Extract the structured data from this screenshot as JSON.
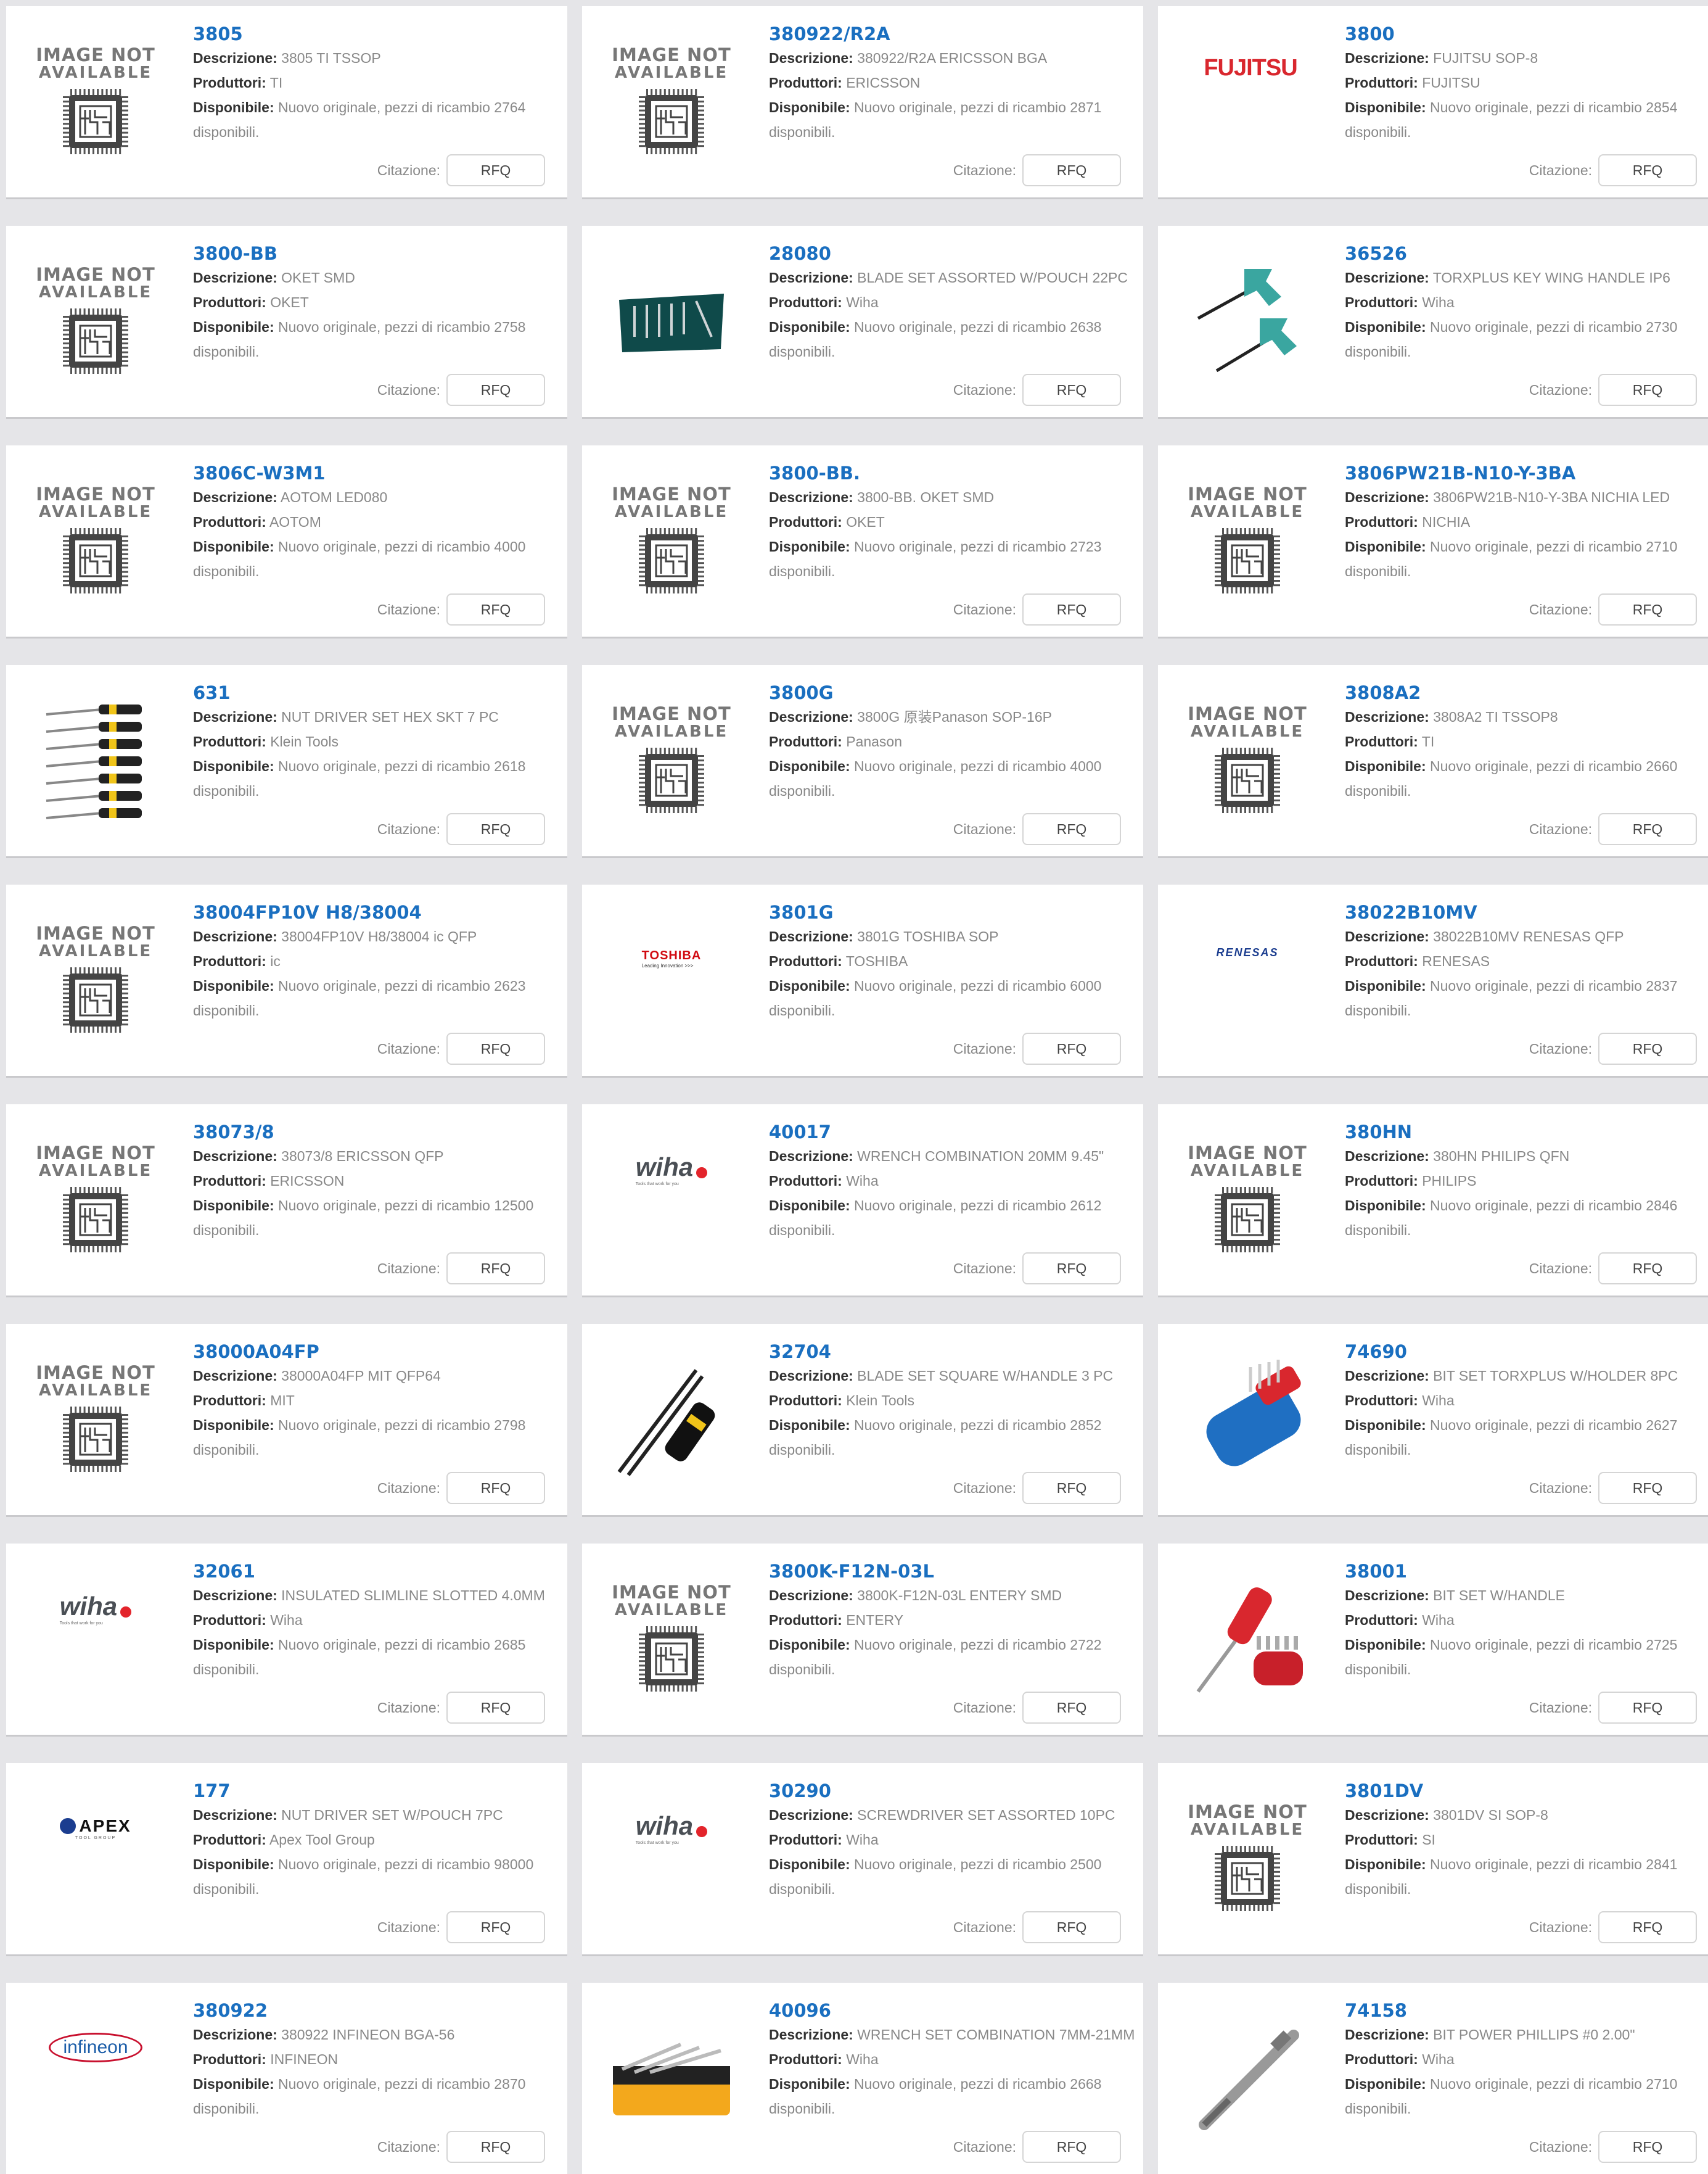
{
  "labels": {
    "descrizione": "Descrizione:",
    "produttori": "Produttori:",
    "disponibile": "Disponibile:",
    "citazione": "Citazione:",
    "rfq": "RFQ",
    "na_line1": "IMAGE NOT",
    "na_line2": "AVAILABLE"
  },
  "products": [
    {
      "pn": "3805",
      "desc": "3805 TI TSSOP",
      "mfr": "TI",
      "avail": "Nuovo originale, pezzi di ricambio 2764",
      "avail2": "disponibili.",
      "img": "na"
    },
    {
      "pn": "380922/R2A",
      "desc": "380922/R2A ERICSSON BGA",
      "mfr": "ERICSSON",
      "avail": "Nuovo originale, pezzi di ricambio 2871",
      "avail2": "disponibili.",
      "img": "na"
    },
    {
      "pn": "3800",
      "desc": "FUJITSU SOP-8",
      "mfr": "FUJITSU",
      "avail": "Nuovo originale, pezzi di ricambio 2854",
      "avail2": "disponibili.",
      "img": "fujitsu",
      "logo": "FUJITSU"
    },
    {
      "pn": "3800-BB",
      "desc": "OKET SMD",
      "mfr": "OKET",
      "avail": "Nuovo originale, pezzi di ricambio 2758",
      "avail2": "disponibili.",
      "img": "na"
    },
    {
      "pn": "28080",
      "desc": "BLADE SET ASSORTED W/POUCH 22PC",
      "mfr": "Wiha",
      "avail": "Nuovo originale, pezzi di ricambio 2638",
      "avail2": "disponibili.",
      "img": "pouch"
    },
    {
      "pn": "36526",
      "desc": "TORXPLUS KEY WING HANDLE IP6",
      "mfr": "Wiha",
      "avail": "Nuovo originale, pezzi di ricambio 2730",
      "avail2": "disponibili.",
      "img": "tkeys"
    },
    {
      "pn": "3806C-W3M1",
      "desc": "AOTOM LED080",
      "mfr": "AOTOM",
      "avail": "Nuovo originale, pezzi di ricambio 4000",
      "avail2": "disponibili.",
      "img": "na"
    },
    {
      "pn": "3800-BB.",
      "desc": "3800-BB. OKET SMD",
      "mfr": "OKET",
      "avail": "Nuovo originale, pezzi di ricambio 2723",
      "avail2": "disponibili.",
      "img": "na"
    },
    {
      "pn": "3806PW21B-N10-Y-3BA",
      "desc": "3806PW21B-N10-Y-3BA NICHIA LED",
      "mfr": "NICHIA",
      "avail": "Nuovo originale, pezzi di ricambio 2710",
      "avail2": "disponibili.",
      "img": "na"
    },
    {
      "pn": "631",
      "desc": "NUT DRIVER SET HEX SKT 7 PC",
      "mfr": "Klein Tools",
      "avail": "Nuovo originale, pezzi di ricambio 2618",
      "avail2": "disponibili.",
      "img": "drivers"
    },
    {
      "pn": "3800G",
      "desc": "3800G 原装Panason SOP-16P",
      "mfr": "Panason",
      "avail": "Nuovo originale, pezzi di ricambio 4000",
      "avail2": "disponibili.",
      "img": "na"
    },
    {
      "pn": "3808A2",
      "desc": "3808A2 TI TSSOP8",
      "mfr": "TI",
      "avail": "Nuovo originale, pezzi di ricambio 2660",
      "avail2": "disponibili.",
      "img": "na"
    },
    {
      "pn": "38004FP10V H8/38004",
      "desc": "38004FP10V H8/38004 ic QFP",
      "mfr": "ic",
      "avail": "Nuovo originale, pezzi di ricambio 2623",
      "avail2": "disponibili.",
      "img": "na"
    },
    {
      "pn": "3801G",
      "desc": "3801G TOSHIBA SOP",
      "mfr": "TOSHIBA",
      "avail": "Nuovo originale, pezzi di ricambio 6000",
      "avail2": "disponibili.",
      "img": "toshiba",
      "logo": "TOSHIBA",
      "logo_sub": "Leading Innovation >>>"
    },
    {
      "pn": "38022B10MV",
      "desc": "38022B10MV RENESAS QFP",
      "mfr": "RENESAS",
      "avail": "Nuovo originale, pezzi di ricambio 2837",
      "avail2": "disponibili.",
      "img": "renesas",
      "logo": "RENESAS"
    },
    {
      "pn": "38073/8",
      "desc": "38073/8 ERICSSON QFP",
      "mfr": "ERICSSON",
      "avail": "Nuovo originale, pezzi di ricambio 12500",
      "avail2": "disponibili.",
      "img": "na"
    },
    {
      "pn": "40017",
      "desc": "WRENCH COMBINATION 20MM 9.45\"",
      "mfr": "Wiha",
      "avail": "Nuovo originale, pezzi di ricambio 2612",
      "avail2": "disponibili.",
      "img": "wiha",
      "logo": "wiha",
      "logo_sub": "Tools that work for you"
    },
    {
      "pn": "380HN",
      "desc": "380HN PHILIPS QFN",
      "mfr": "PHILIPS",
      "avail": "Nuovo originale, pezzi di ricambio 2846",
      "avail2": "disponibili.",
      "img": "na"
    },
    {
      "pn": "38000A04FP",
      "desc": "38000A04FP MIT QFP64",
      "mfr": "MIT",
      "avail": "Nuovo originale, pezzi di ricambio 2798",
      "avail2": "disponibili.",
      "img": "na"
    },
    {
      "pn": "32704",
      "desc": "BLADE SET SQUARE W/HANDLE 3 PC",
      "mfr": "Klein Tools",
      "avail": "Nuovo originale, pezzi di ricambio 2852",
      "avail2": "disponibili.",
      "img": "blades"
    },
    {
      "pn": "74690",
      "desc": "BIT SET TORXPLUS W/HOLDER 8PC",
      "mfr": "Wiha",
      "avail": "Nuovo originale, pezzi di ricambio 2627",
      "avail2": "disponibili.",
      "img": "bitholder"
    },
    {
      "pn": "32061",
      "desc": "INSULATED SLIMLINE SLOTTED 4.0MM",
      "mfr": "Wiha",
      "avail": "Nuovo originale, pezzi di ricambio 2685",
      "avail2": "disponibili.",
      "img": "wiha",
      "logo": "wiha",
      "logo_sub": "Tools that work for you"
    },
    {
      "pn": "3800K-F12N-03L",
      "desc": "3800K-F12N-03L ENTERY SMD",
      "mfr": "ENTERY",
      "avail": "Nuovo originale, pezzi di ricambio 2722",
      "avail2": "disponibili.",
      "img": "na"
    },
    {
      "pn": "38001",
      "desc": "BIT SET W/HANDLE",
      "mfr": "Wiha",
      "avail": "Nuovo originale, pezzi di ricambio 2725",
      "avail2": "disponibili.",
      "img": "bitset"
    },
    {
      "pn": "177",
      "desc": "NUT DRIVER SET W/POUCH 7PC",
      "mfr": "Apex Tool Group",
      "avail": "Nuovo originale, pezzi di ricambio 98000",
      "avail2": "disponibili.",
      "img": "apex",
      "logo": "APEX",
      "logo_sub": "TOOL GROUP"
    },
    {
      "pn": "30290",
      "desc": "SCREWDRIVER SET ASSORTED 10PC",
      "mfr": "Wiha",
      "avail": "Nuovo originale, pezzi di ricambio 2500",
      "avail2": "disponibili.",
      "img": "wiha",
      "logo": "wiha",
      "logo_sub": "Tools that work for you"
    },
    {
      "pn": "3801DV",
      "desc": "3801DV SI SOP-8",
      "mfr": "SI",
      "avail": "Nuovo originale, pezzi di ricambio 2841",
      "avail2": "disponibili.",
      "img": "na"
    },
    {
      "pn": "380922",
      "desc": "380922 INFINEON BGA-56",
      "mfr": "INFINEON",
      "avail": "Nuovo originale, pezzi di ricambio 2870",
      "avail2": "disponibili.",
      "img": "infineon",
      "logo": "infineon"
    },
    {
      "pn": "40096",
      "desc": "WRENCH SET COMBINATION 7MM-21MM",
      "mfr": "Wiha",
      "avail": "Nuovo originale, pezzi di ricambio 2668",
      "avail2": "disponibili.",
      "img": "wrenchset"
    },
    {
      "pn": "74158",
      "desc": "BIT POWER PHILLIPS #0 2.00\"",
      "mfr": "Wiha",
      "avail": "Nuovo originale, pezzi di ricambio 2710",
      "avail2": "disponibili.",
      "img": "bit"
    }
  ]
}
